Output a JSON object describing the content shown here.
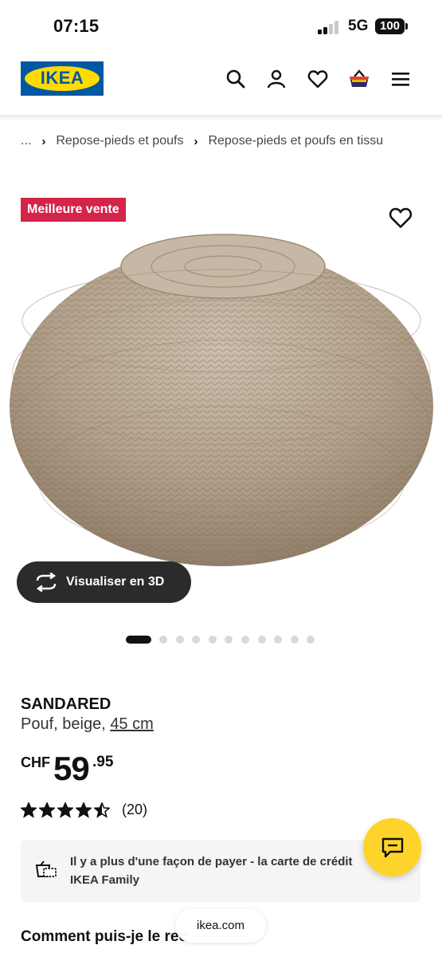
{
  "status_bar": {
    "time": "07:15",
    "network": "5G",
    "battery": "100"
  },
  "header": {
    "logo_text": "IKEA",
    "icons": [
      "search-icon",
      "account-icon",
      "heart-icon",
      "basket-icon",
      "menu-icon"
    ]
  },
  "breadcrumb": {
    "ellipsis": "...",
    "items": [
      "Repose-pieds et poufs",
      "Repose-pieds et poufs en tissu"
    ],
    "separator": "›"
  },
  "product": {
    "badge": "Meilleure vente",
    "view_3d_label": "Visualiser en 3D",
    "gallery": {
      "total_images": 11,
      "active_index": 0
    },
    "name": "SANDARED",
    "description": "Pouf, beige, ",
    "size_link": "45 cm",
    "price": {
      "currency": "CHF",
      "integer": "59",
      "decimals": ".95"
    },
    "rating": {
      "stars": 4.5,
      "max": 5,
      "count_label": "(20)"
    }
  },
  "promo": {
    "text": "Il y a plus d'une façon de payer - la carte de crédit IKEA Family",
    "icon": "cart-card-icon"
  },
  "chat": {
    "icon": "chat-icon"
  },
  "section_title": "Comment puis-je le rec",
  "browser": {
    "url": "ikea.com"
  },
  "colors": {
    "brand_blue": "#0058a3",
    "brand_yellow": "#ffdb00",
    "badge": "#d4244a",
    "chat": "#ffd42a"
  }
}
